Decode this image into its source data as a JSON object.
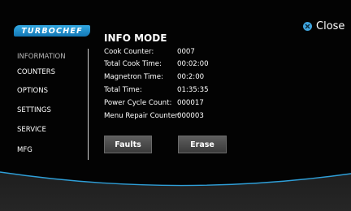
{
  "brand": {
    "logo_text": "TURBOCHEF"
  },
  "header": {
    "close_label": "Close",
    "title": "INFO MODE"
  },
  "sidebar": {
    "items": [
      {
        "label": "INFORMATION",
        "active": true
      },
      {
        "label": "COUNTERS",
        "active": false
      },
      {
        "label": "OPTIONS",
        "active": false
      },
      {
        "label": "SETTINGS",
        "active": false
      },
      {
        "label": "SERVICE",
        "active": false
      },
      {
        "label": "MFG",
        "active": false
      }
    ]
  },
  "info": {
    "rows": [
      {
        "label": "Cook Counter:",
        "value": "0007"
      },
      {
        "label": "Total Cook Time:",
        "value": "00:02:00"
      },
      {
        "label": "Magnetron Time:",
        "value": "00:2:00"
      },
      {
        "label": "Total Time:",
        "value": "01:35:35"
      },
      {
        "label": "Power Cycle Count:",
        "value": "000017"
      },
      {
        "label": "Menu Repair Counter:",
        "value": "000003"
      }
    ]
  },
  "actions": {
    "faults_label": "Faults",
    "erase_label": "Erase"
  },
  "colors": {
    "accent": "#3fa4de",
    "logo_bg": "#1a86c8",
    "wave": "#2f9fd8",
    "background": "#030303"
  }
}
